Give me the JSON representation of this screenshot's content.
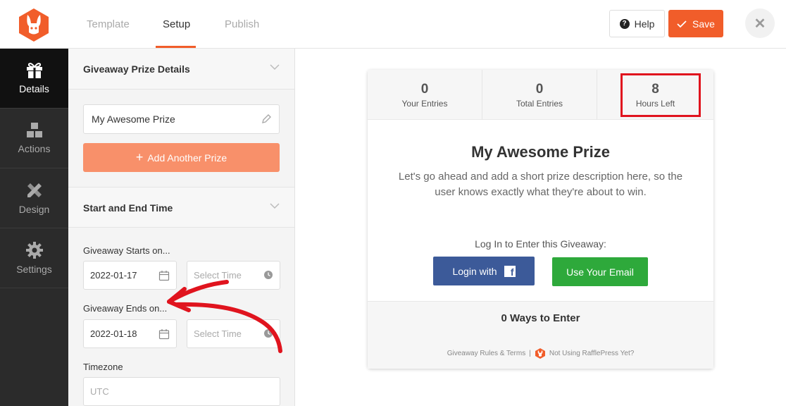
{
  "header": {
    "tabs": [
      {
        "label": "Template"
      },
      {
        "label": "Setup"
      },
      {
        "label": "Publish"
      }
    ],
    "help_label": "Help",
    "save_label": "Save",
    "accent_color": "#f15d2a"
  },
  "sidebar": {
    "items": [
      {
        "label": "Details",
        "icon": "gift-icon"
      },
      {
        "label": "Actions",
        "icon": "cubes-icon"
      },
      {
        "label": "Design",
        "icon": "pencil-ruler-icon"
      },
      {
        "label": "Settings",
        "icon": "gear-icon"
      }
    ]
  },
  "panel": {
    "prize_section_title": "Giveaway Prize Details",
    "prize_name": "My Awesome Prize",
    "add_prize_label": "Add Another Prize",
    "time_section_title": "Start and End Time",
    "starts_label": "Giveaway Starts on...",
    "start_date": "2022-01-17",
    "start_time_placeholder": "Select Time",
    "ends_label": "Giveaway Ends on...",
    "end_date": "2022-01-18",
    "end_time_placeholder": "Select Time",
    "timezone_label": "Timezone",
    "timezone_value": "UTC"
  },
  "preview": {
    "stats": [
      {
        "value": "0",
        "label": "Your Entries"
      },
      {
        "value": "0",
        "label": "Total Entries"
      },
      {
        "value": "8",
        "label": "Hours Left"
      }
    ],
    "prize_title": "My Awesome Prize",
    "prize_description": "Let's go ahead and add a short prize description here, so the user knows exactly what they're about to win.",
    "login_text": "Log In to Enter this Giveaway:",
    "facebook_button": "Login with",
    "email_button": "Use Your Email",
    "ways_to_enter": "0 Ways to Enter",
    "footer_rules": "Giveaway Rules & Terms",
    "footer_separator": "|",
    "footer_promo": "Not Using RafflePress Yet?",
    "facebook_color": "#3c5a99",
    "email_color": "#2ea93b",
    "highlight_color": "#e0141e"
  }
}
